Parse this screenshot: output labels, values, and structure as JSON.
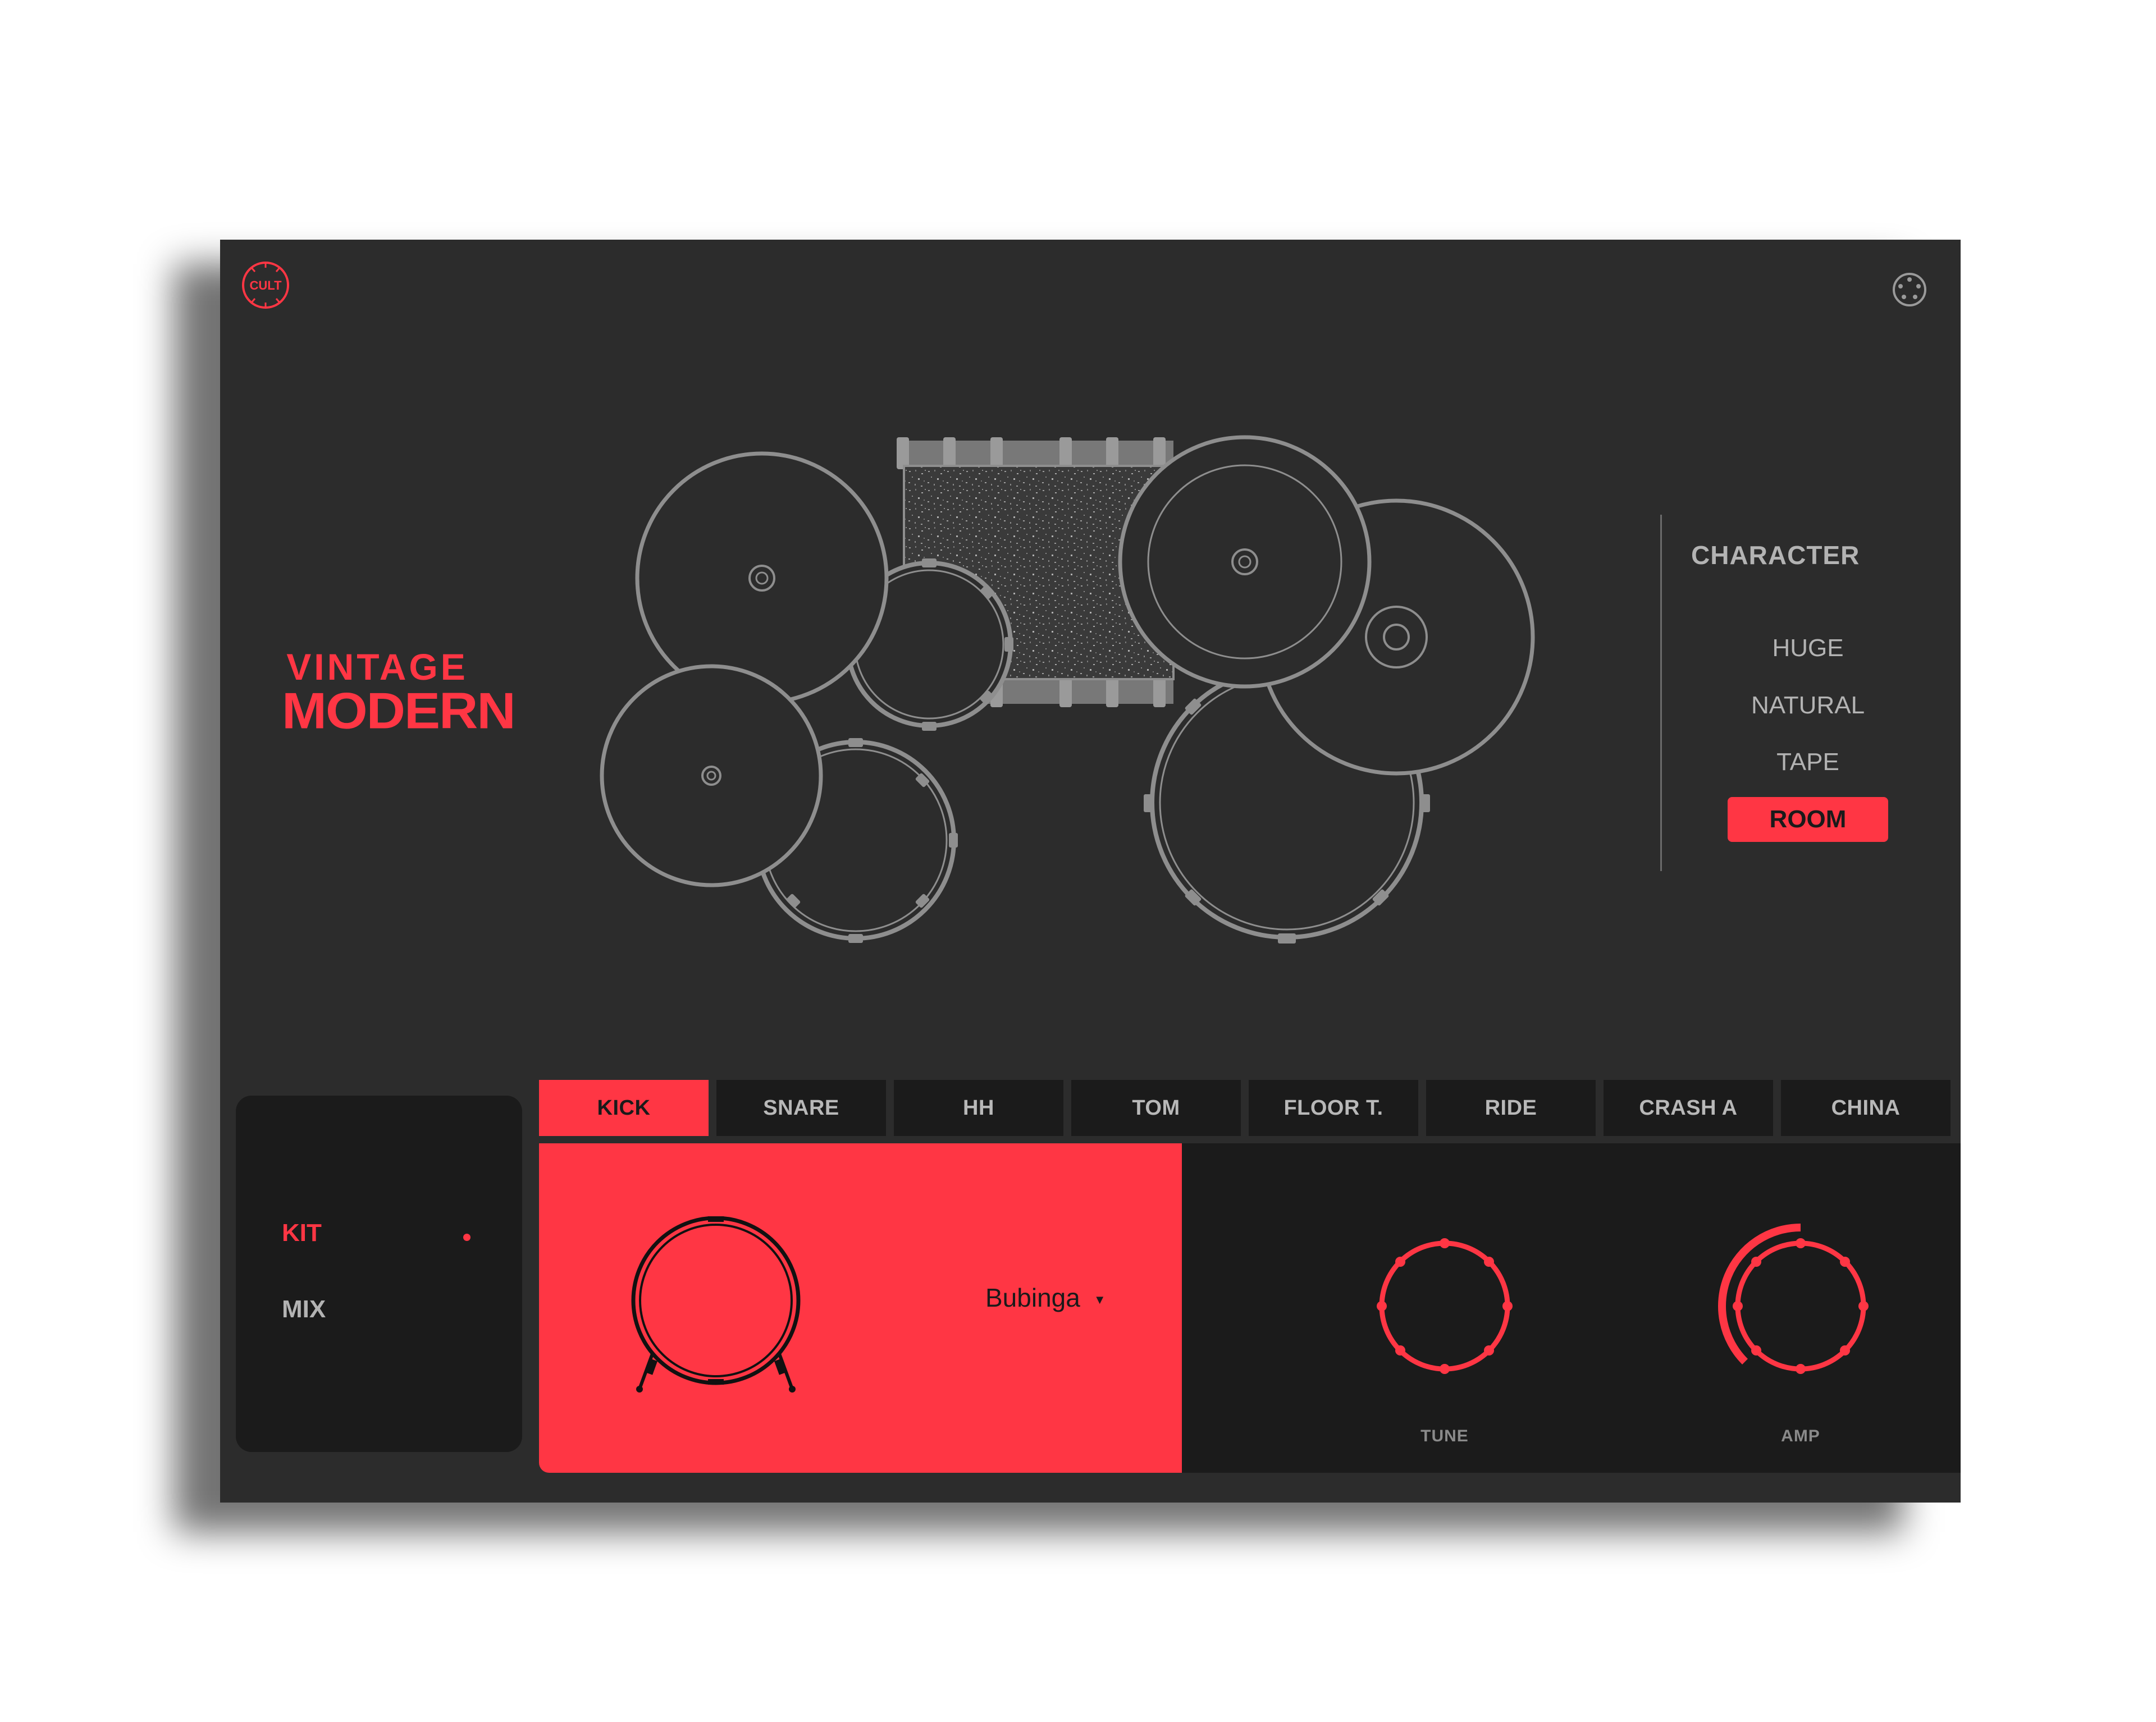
{
  "app": {
    "logo_text": "CULT",
    "brand": {
      "line1": "VINTAGE",
      "line2": "MODERN"
    }
  },
  "character": {
    "title": "CHARACTER",
    "options": [
      "HUGE",
      "NATURAL",
      "TAPE",
      "ROOM"
    ],
    "selected": "ROOM"
  },
  "side_menu": {
    "items": [
      {
        "label": "KIT",
        "active": true
      },
      {
        "label": "MIX",
        "active": false
      }
    ]
  },
  "tabs": {
    "items": [
      "KICK",
      "SNARE",
      "HH",
      "TOM",
      "FLOOR T.",
      "RIDE",
      "CRASH A",
      "CHINA"
    ],
    "selected": "KICK"
  },
  "kick_panel": {
    "shell_select": {
      "value": "Bubinga"
    }
  },
  "knobs": [
    {
      "label": "TUNE"
    },
    {
      "label": "AMP",
      "level": 0.5
    }
  ],
  "icons": {
    "logo": "cult-logo-icon",
    "settings": "settings-gear-icon",
    "kick": "kick-drum-icon",
    "dropdown": "caret-down-icon"
  },
  "colors": {
    "accent": "#ff3644",
    "background": "#2c2c2c",
    "panel": "#1b1b1b",
    "text_muted": "#b3b3b3",
    "kit_line": "#8e8e8e"
  }
}
